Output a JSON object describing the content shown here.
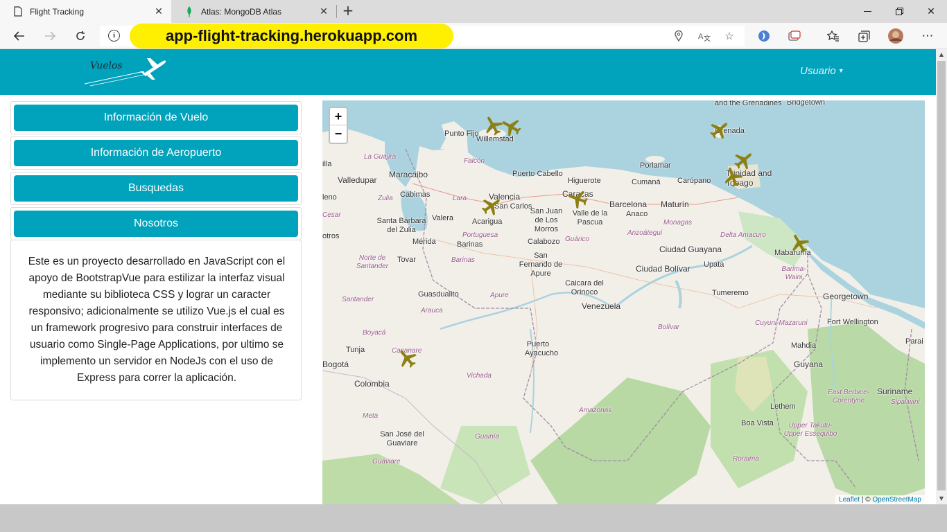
{
  "browser": {
    "tabs": [
      {
        "title": "Flight Tracking",
        "icon": "page-icon"
      },
      {
        "title": "Atlas: MongoDB Atlas",
        "icon": "mongodb-leaf-icon"
      }
    ],
    "url": "app-flight-tracking.herokuapp.com"
  },
  "navbar": {
    "brand": "Vuelos",
    "user_menu": "Usuario"
  },
  "sidebar": {
    "buttons": [
      {
        "label": "Información de Vuelo"
      },
      {
        "label": "Información de Aeropuerto"
      },
      {
        "label": "Busquedas"
      },
      {
        "label": "Nosotros"
      }
    ],
    "about": "Este es un proyecto desarrollado en JavaScript con el apoyo de BootstrapVue para estilizar la interfaz visual mediante su biblioteca CSS y lograr un caracter responsivo; adicionalmente se utilizo Vue.js el cual es un framework progresivo para construir interfaces de usuario como Single-Page Applications, por ultimo se implemento un servidor en NodeJs con el uso de Express para correr la aplicación."
  },
  "map": {
    "zoom_in": "+",
    "zoom_out": "−",
    "attribution_leaflet": "Leaflet",
    "attribution_sep": " | © ",
    "attribution_osm": "OpenStreetMap",
    "labels": {
      "grenadines": "and the Grenadines",
      "bridgetown": "Bridgetown",
      "grenada": "Grenada",
      "punto_fijo": "Punto Fijo",
      "willemstad": "Willemstad",
      "la_guajira": "La Guajira",
      "falcon": "Falcón",
      "maracaibo": "Maracaibo",
      "valledupar": "Valledupar",
      "puerto_cabello": "Puerto Cabello",
      "higuerote": "Higuerote",
      "porlamar": "Porlamar",
      "trinidad": "Trinidad and Tobago",
      "cumana": "Cumaná",
      "carupano": "Carúpano",
      "cabimas": "Cabimas",
      "valencia": "Valencia",
      "caracas": "Caracas",
      "barcelona": "Barcelona",
      "maturin": "Maturín",
      "zulia": "Zulia",
      "lara": "Lara",
      "san_carlos": "San Carlos",
      "san_juan": "San Juan de Los Morros",
      "valle_pascua": "Valle de la Pascua",
      "anaco": "Anaco",
      "cesar": "Cesar",
      "santa_barbara": "Santa Bárbara del Zulia",
      "valera": "Valera",
      "acarigua": "Acarigua",
      "monagas": "Monagas",
      "delta": "Delta Amacuro",
      "anzoategui": "Anzoátegui",
      "portuguesa": "Portuguesa",
      "guarico": "Guárico",
      "merida": "Mérida",
      "calabozo": "Calabozo",
      "barinas": "Barinas",
      "ciudad_guayana": "Ciudad Guayana",
      "mabaruma": "Mabaruma",
      "norte_santander": "Norte de Santander",
      "tovar": "Tovar",
      "barinas_state": "Barinas",
      "san_fernando": "San Fernando de Apure",
      "ciudad_bolivar": "Ciudad Bolívar",
      "upata": "Upata",
      "barima": "Barima-Waini",
      "caicara": "Caicara del Orinoco",
      "guasdualito": "Guasdualito",
      "apure": "Apure",
      "tumeremo": "Tumeremo",
      "georgetown": "Georgetown",
      "santander": "Santander",
      "arauca": "Arauca",
      "venezuela": "Venezuela",
      "bolivar": "Bolívar",
      "cuyuni": "Cuyuni-Mazaruni",
      "fort_wellington": "Fort Wellington",
      "boyaca": "Boyacá",
      "puerto_ayacucho": "Puerto Ayacucho",
      "mahdia": "Mahdia",
      "parai": "Parai",
      "tunja": "Tunja",
      "casanare": "Casanare",
      "bogota": "Bogotá",
      "guyana": "Guyana",
      "colombia": "Colombia",
      "vichada": "Vichada",
      "suriname": "Suriname",
      "east_berbice": "East Berbice-Corentyne",
      "sipaliwini": "Sipaliwini",
      "lethem": "Lethem",
      "meta": "Meta",
      "amazonas": "Amazonas",
      "boa_vista": "Boa Vista",
      "upper_takutu": "Upper Takutu-Upper Essequibo",
      "san_jose": "San José del Guaviare",
      "guainia": "Guainía",
      "guaviare": "Guaviare",
      "roraima": "Roraima",
      "illa": "illa",
      "leno": "leno",
      "otros": "otros"
    }
  },
  "colors": {
    "primary": "#00a2bc",
    "sea": "#aad3df",
    "land": "#f2efe9",
    "plane": "#8c8014"
  }
}
